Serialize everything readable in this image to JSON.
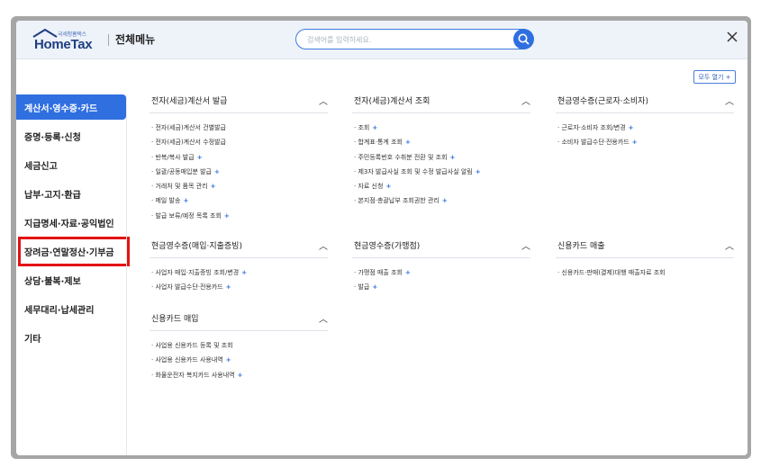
{
  "header": {
    "logo_small": "국세청홈택스",
    "logo_big": "HomeTax",
    "title": "전체메뉴",
    "search_placeholder": "검색어를 입력하세요."
  },
  "all_open_label": "모두 열기 +",
  "sidebar": {
    "items": [
      {
        "label": "계산서·영수증·카드"
      },
      {
        "label": "증명·등록·신청"
      },
      {
        "label": "세금신고"
      },
      {
        "label": "납부·고지·환급"
      },
      {
        "label": "지급명세·자료·공익법인"
      },
      {
        "label": "장려금·연말정산·기부금"
      },
      {
        "label": "상담·불복·제보"
      },
      {
        "label": "세무대리·납세관리"
      },
      {
        "label": "기타"
      }
    ]
  },
  "sections": [
    {
      "title": "전자(세금)계산서 발급",
      "links": [
        {
          "text": "· 전자(세금)계산서 건별발급",
          "plus": ""
        },
        {
          "text": "· 전자(세금)계산서 수정발급",
          "plus": ""
        },
        {
          "text": "· 반복/복사 발급",
          "plus": "+"
        },
        {
          "text": "· 일괄/공동매입분 발급",
          "plus": "+"
        },
        {
          "text": "· 거래처 및 품목 관리",
          "plus": "+"
        },
        {
          "text": "· 메일 발송",
          "plus": "+"
        },
        {
          "text": "· 발급 보류/예정 목록 조회",
          "plus": "+"
        }
      ]
    },
    {
      "title": "전자(세금)계산서 조회",
      "links": [
        {
          "text": "· 조회",
          "plus": "+"
        },
        {
          "text": "· 합계표·통계 조회",
          "plus": "+"
        },
        {
          "text": "· 주민등록번호 수취분 전환 및 조회",
          "plus": "+"
        },
        {
          "text": "· 제3자 발급사실 조회 및 수정 발급사실 알림",
          "plus": "+"
        },
        {
          "text": "· 자료 신청",
          "plus": "+"
        },
        {
          "text": "· 본지점·총괄납부 조회권한 관리",
          "plus": "+"
        }
      ]
    },
    {
      "title": "현금영수증(근로자·소비자)",
      "links": [
        {
          "text": "· 근로자·소비자 조회/변경",
          "plus": "+"
        },
        {
          "text": "· 소비자 발급수단·전용카드",
          "plus": "+"
        }
      ]
    },
    {
      "title": "현금영수증(매입·지출증빙)",
      "links": [
        {
          "text": "· 사업자 매입·지출증빙 조회/변경",
          "plus": "+"
        },
        {
          "text": "· 사업자 발급수단·전용카드",
          "plus": "+"
        }
      ]
    },
    {
      "title": "현금영수증(가맹점)",
      "links": [
        {
          "text": "· 가맹점 매출 조회",
          "plus": "+"
        },
        {
          "text": "· 발급",
          "plus": "+"
        }
      ]
    },
    {
      "title": "신용카드 매출",
      "links": [
        {
          "text": "· 신용카드·판매(결제)대행 매출자료 조회",
          "plus": ""
        }
      ]
    },
    {
      "title": "신용카드 매입",
      "links": [
        {
          "text": "· 사업용 신용카드 등록 및 조회",
          "plus": ""
        },
        {
          "text": "· 사업용 신용카드 사용내역",
          "plus": "+"
        },
        {
          "text": "· 화물운전자 복지카드 사용내역",
          "plus": "+"
        }
      ]
    }
  ],
  "colors": {
    "accent": "#2f6fe0",
    "highlight_box": "#e31212",
    "header_bg": "#eef2f9"
  }
}
